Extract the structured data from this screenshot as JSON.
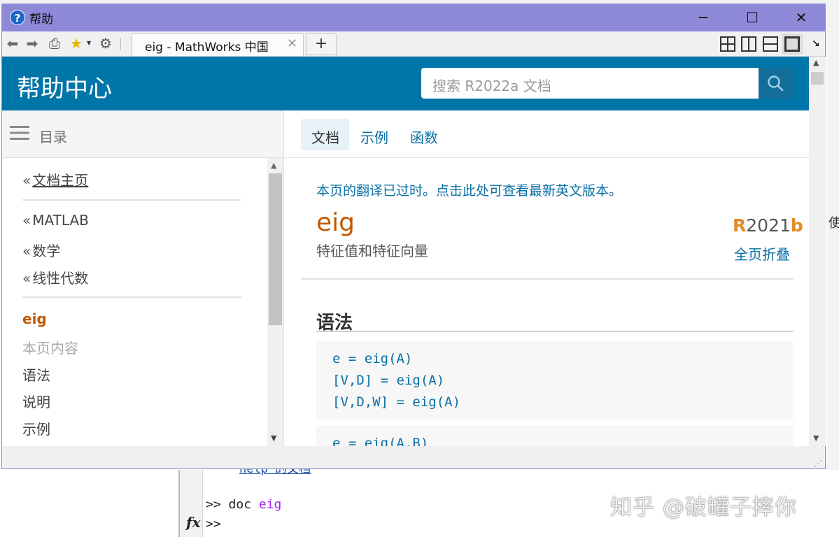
{
  "window": {
    "title": "帮助",
    "minimize": "─",
    "maximize": "☐",
    "close": "✕"
  },
  "toolbar": {
    "tab_label": "eig - MathWorks 中国",
    "tab_close": "✕",
    "new_tab": "+"
  },
  "header": {
    "title": "帮助中心",
    "search_placeholder": "搜索 R2022a 文档"
  },
  "sidebar": {
    "toc_label": "目录",
    "doc_home": "文档主页",
    "breadcrumbs": [
      "MATLAB",
      "数学",
      "线性代数"
    ],
    "current": "eig",
    "on_this_page": "本页内容",
    "sections": [
      "语法",
      "说明",
      "示例"
    ]
  },
  "content": {
    "tabs": [
      "文档",
      "示例",
      "函数"
    ],
    "translation_note": "本页的翻译已过时。点击此处可查看最新英文版本。",
    "func_name": "eig",
    "func_summary": "特征值和特征向量",
    "release_prefix": "R",
    "release_year": "2021",
    "release_suffix": "b",
    "collapse_all": "全页折叠",
    "syntax_heading": "语法",
    "code_lines": [
      "e = eig(A)",
      "[V,D] = eig(A)",
      "[V,D,W] = eig(A)",
      "e = eig(A,B)"
    ]
  },
  "background": {
    "link_text": "help 的文档",
    "cmd_prompt": ">> ",
    "cmd_text": "doc ",
    "cmd_arg": "eig",
    "prompt2": ">>",
    "fx": "fx",
    "right_char": "使",
    "watermark": "知乎 @破罐子摔你"
  },
  "colors": {
    "header_blue": "#0076a8",
    "title_bar": "#8e88d9",
    "accent_orange": "#c05a00",
    "link_blue": "#0b6fa4"
  }
}
